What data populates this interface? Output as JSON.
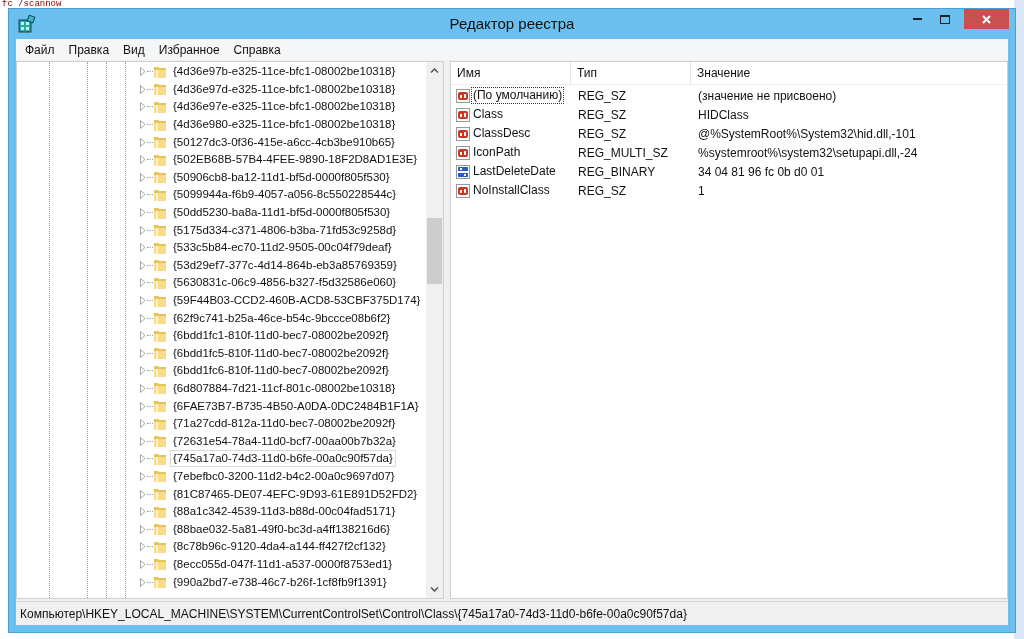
{
  "background": {
    "command_text": "fc /scannow"
  },
  "window": {
    "title": "Редактор реестра"
  },
  "menu": [
    "Файл",
    "Правка",
    "Вид",
    "Избранное",
    "Справка"
  ],
  "tree": {
    "items": [
      {
        "label": "{4d36e97b-e325-11ce-bfc1-08002be10318}",
        "selected": false
      },
      {
        "label": "{4d36e97d-e325-11ce-bfc1-08002be10318}",
        "selected": false
      },
      {
        "label": "{4d36e97e-e325-11ce-bfc1-08002be10318}",
        "selected": false
      },
      {
        "label": "{4d36e980-e325-11ce-bfc1-08002be10318}",
        "selected": false
      },
      {
        "label": "{50127dc3-0f36-415e-a6cc-4cb3be910b65}",
        "selected": false
      },
      {
        "label": "{502EB68B-57B4-4FEE-9890-18F2D8AD1E3E}",
        "selected": false
      },
      {
        "label": "{50906cb8-ba12-11d1-bf5d-0000f805f530}",
        "selected": false
      },
      {
        "label": "{5099944a-f6b9-4057-a056-8c550228544c}",
        "selected": false
      },
      {
        "label": "{50dd5230-ba8a-11d1-bf5d-0000f805f530}",
        "selected": false
      },
      {
        "label": "{5175d334-c371-4806-b3ba-71fd53c9258d}",
        "selected": false
      },
      {
        "label": "{533c5b84-ec70-11d2-9505-00c04f79deaf}",
        "selected": false
      },
      {
        "label": "{53d29ef7-377c-4d14-864b-eb3a85769359}",
        "selected": false
      },
      {
        "label": "{5630831c-06c9-4856-b327-f5d32586e060}",
        "selected": false
      },
      {
        "label": "{59F44B03-CCD2-460B-ACD8-53CBF375D174}",
        "selected": false
      },
      {
        "label": "{62f9c741-b25a-46ce-b54c-9bccce08b6f2}",
        "selected": false
      },
      {
        "label": "{6bdd1fc1-810f-11d0-bec7-08002be2092f}",
        "selected": false
      },
      {
        "label": "{6bdd1fc5-810f-11d0-bec7-08002be2092f}",
        "selected": false
      },
      {
        "label": "{6bdd1fc6-810f-11d0-bec7-08002be2092f}",
        "selected": false
      },
      {
        "label": "{6d807884-7d21-11cf-801c-08002be10318}",
        "selected": false
      },
      {
        "label": "{6FAE73B7-B735-4B50-A0DA-0DC2484B1F1A}",
        "selected": false
      },
      {
        "label": "{71a27cdd-812a-11d0-bec7-08002be2092f}",
        "selected": false
      },
      {
        "label": "{72631e54-78a4-11d0-bcf7-00aa00b7b32a}",
        "selected": false
      },
      {
        "label": "{745a17a0-74d3-11d0-b6fe-00a0c90f57da}",
        "selected": true
      },
      {
        "label": "{7ebefbc0-3200-11d2-b4c2-00a0c9697d07}",
        "selected": false
      },
      {
        "label": "{81C87465-DE07-4EFC-9D93-61E891D52FD2}",
        "selected": false
      },
      {
        "label": "{88a1c342-4539-11d3-b88d-00c04fad5171}",
        "selected": false
      },
      {
        "label": "{88bae032-5a81-49f0-bc3d-a4ff138216d6}",
        "selected": false
      },
      {
        "label": "{8c78b96c-9120-4da4-a144-ff427f2cf132}",
        "selected": false
      },
      {
        "label": "{8ecc055d-047f-11d1-a537-0000f8753ed1}",
        "selected": false
      },
      {
        "label": "{990a2bd7-e738-46c7-b26f-1cf8fb9f1391}",
        "selected": false
      }
    ]
  },
  "values": {
    "columns": [
      "Имя",
      "Тип",
      "Значение"
    ],
    "rows": [
      {
        "kind": "string",
        "name": "(По умолчанию)",
        "type": "REG_SZ",
        "value": "(значение не присвоено)",
        "selected": true
      },
      {
        "kind": "string",
        "name": "Class",
        "type": "REG_SZ",
        "value": "HIDClass",
        "selected": false
      },
      {
        "kind": "string",
        "name": "ClassDesc",
        "type": "REG_SZ",
        "value": "@%SystemRoot%\\System32\\hid.dll,-101",
        "selected": false
      },
      {
        "kind": "string",
        "name": "IconPath",
        "type": "REG_MULTI_SZ",
        "value": "%systemroot%\\system32\\setupapi.dll,-24",
        "selected": false
      },
      {
        "kind": "binary",
        "name": "LastDeleteDate",
        "type": "REG_BINARY",
        "value": "34 04 81 96 fc 0b d0 01",
        "selected": false
      },
      {
        "kind": "string",
        "name": "NoInstallClass",
        "type": "REG_SZ",
        "value": "1",
        "selected": false
      }
    ]
  },
  "status_bar": "Компьютер\\HKEY_LOCAL_MACHINE\\SYSTEM\\CurrentControlSet\\Control\\Class\\{745a17a0-74d3-11d0-b6fe-00a0c90f57da}"
}
